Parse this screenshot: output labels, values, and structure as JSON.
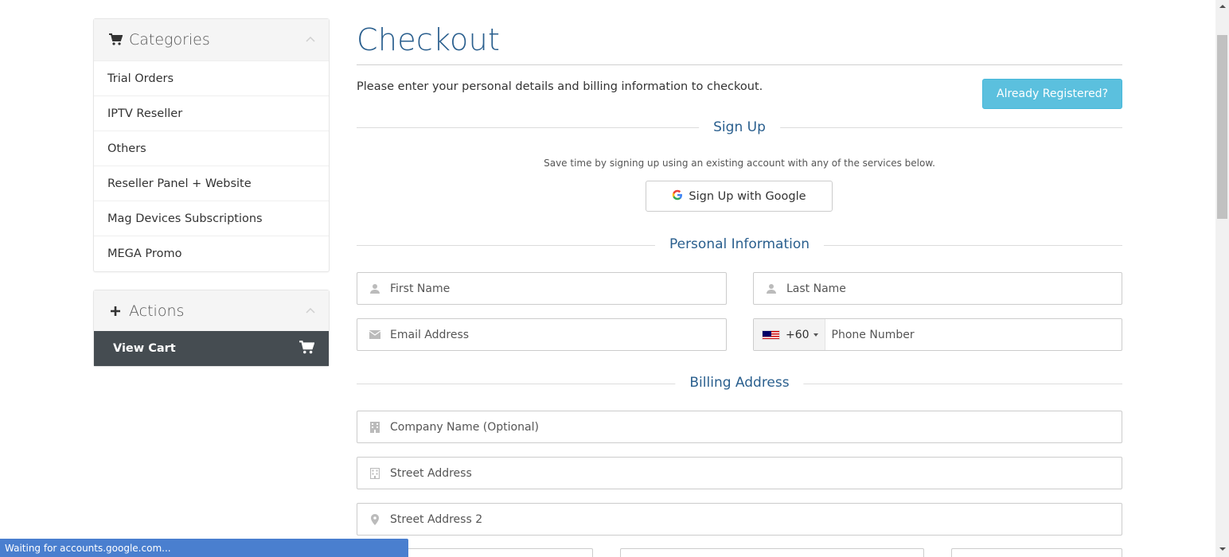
{
  "sidebar": {
    "categories": {
      "title": "Categories",
      "items": [
        {
          "label": "Trial Orders"
        },
        {
          "label": "IPTV Reseller"
        },
        {
          "label": "Others"
        },
        {
          "label": "Reseller Panel + Website"
        },
        {
          "label": "Mag Devices Subscriptions"
        },
        {
          "label": "MEGA Promo"
        }
      ]
    },
    "actions": {
      "title": "Actions",
      "view_cart": "View Cart"
    }
  },
  "main": {
    "title": "Checkout",
    "intro": "Please enter your personal details and billing information to checkout.",
    "already_registered": "Already Registered?",
    "signup": {
      "heading": "Sign Up",
      "helper": "Save time by signing up using an existing account with any of the services below.",
      "google_button": "Sign Up with Google"
    },
    "personal": {
      "heading": "Personal Information",
      "first_name": "First Name",
      "last_name": "Last Name",
      "email": "Email Address",
      "phone_code": "+60",
      "phone": "Phone Number"
    },
    "billing": {
      "heading": "Billing Address",
      "company": "Company Name (Optional)",
      "street": "Street Address",
      "street2": "Street Address 2"
    }
  },
  "status_bar": {
    "text": "Waiting for accounts.google.com..."
  },
  "colors": {
    "accent": "#2a5f8e",
    "info_button": "#5bc0de",
    "dark_panel": "#454c51",
    "status_bar": "#4a7fcf"
  },
  "icons": {
    "categories": "cart-icon",
    "actions": "plus-icon",
    "view_cart": "cart-icon",
    "google": "google-icon",
    "first_name": "user-icon",
    "last_name": "user-icon",
    "email": "envelope-icon",
    "phone": "malaysia-flag-icon",
    "company": "building-icon",
    "street": "building-icon",
    "street2": "map-marker-icon"
  }
}
